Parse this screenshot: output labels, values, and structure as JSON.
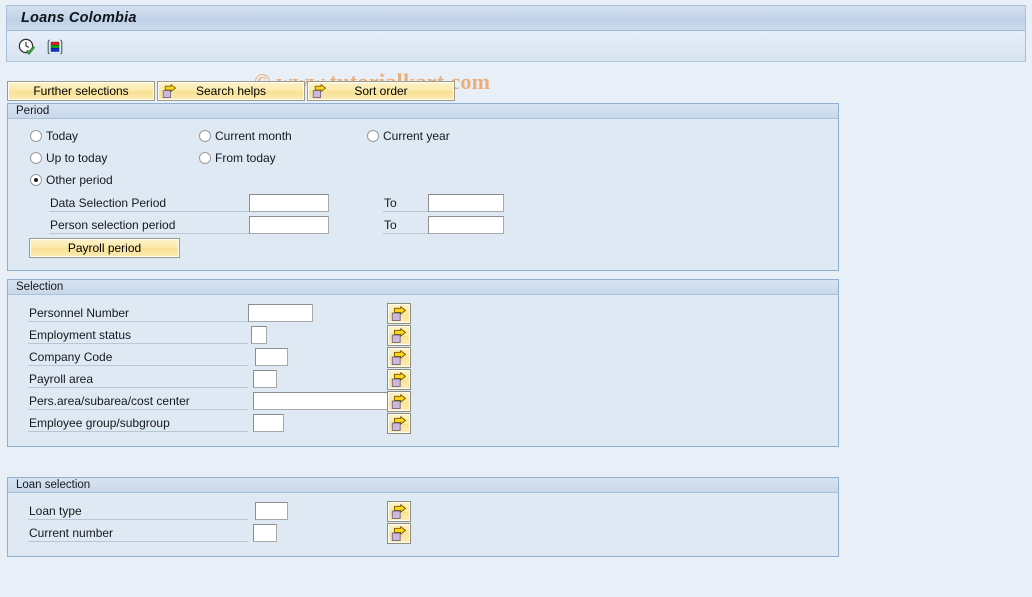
{
  "window": {
    "title": "Loans Colombia"
  },
  "toolbar": {
    "icons": [
      {
        "name": "execute-clock-icon",
        "tooltip": "Execute"
      },
      {
        "name": "variant-icon",
        "tooltip": "Get Variant"
      }
    ]
  },
  "watermark": {
    "text": "© www.tutorialkart.com"
  },
  "buttons": {
    "further_selections": "Further selections",
    "search_helps": "Search helps",
    "sort_order": "Sort order"
  },
  "period": {
    "legend": "Period",
    "options": [
      {
        "label": "Today",
        "selected": false
      },
      {
        "label": "Current month",
        "selected": false
      },
      {
        "label": "Current year",
        "selected": false
      },
      {
        "label": "Up to today",
        "selected": false
      },
      {
        "label": "From today",
        "selected": false
      },
      {
        "label": "Other period",
        "selected": true
      }
    ],
    "rows": [
      {
        "label": "Data Selection Period",
        "value": "",
        "to_label": "To",
        "to_value": ""
      },
      {
        "label": "Person selection period",
        "value": "",
        "to_label": "To",
        "to_value": ""
      }
    ],
    "payroll_period_button": "Payroll period"
  },
  "selection": {
    "legend": "Selection",
    "rows": [
      {
        "label": "Personnel Number",
        "value": ""
      },
      {
        "label": "Employment status",
        "value": ""
      },
      {
        "label": "Company Code",
        "value": ""
      },
      {
        "label": "Payroll area",
        "value": ""
      },
      {
        "label": "Pers.area/subarea/cost center",
        "value": ""
      },
      {
        "label": "Employee group/subgroup",
        "value": ""
      }
    ]
  },
  "loan_selection": {
    "legend": "Loan selection",
    "rows": [
      {
        "label": "Loan type",
        "value": ""
      },
      {
        "label": "Current number",
        "value": ""
      }
    ]
  },
  "colors": {
    "background": "#e8eef7",
    "panel": "#dfe9f4",
    "title_bar": "#c5d6ea",
    "button_yellow": "#fbe9a8",
    "accent_border": "#8fb0d0",
    "watermark": "#eaab74"
  }
}
